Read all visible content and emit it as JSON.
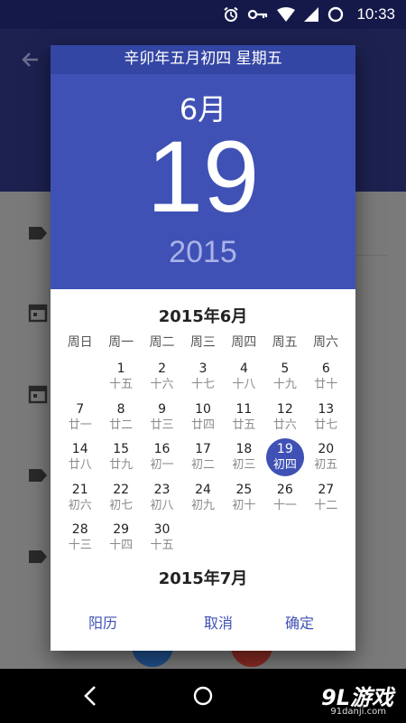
{
  "status_bar": {
    "time": "10:33",
    "icons": [
      "alarm-icon",
      "key-icon",
      "wifi-icon",
      "signal-icon",
      "battery-icon"
    ]
  },
  "dialog": {
    "lunar_header": "辛卯年五月初四 星期五",
    "selected_month": "6月",
    "selected_day": "19",
    "selected_year": "2015",
    "month_title": "2015年6月",
    "next_month_title": "2015年7月",
    "weekdays": [
      "周日",
      "周一",
      "周二",
      "周三",
      "周四",
      "周五",
      "周六"
    ],
    "days": [
      {
        "g": "1",
        "l": "十五"
      },
      {
        "g": "2",
        "l": "十六"
      },
      {
        "g": "3",
        "l": "十七"
      },
      {
        "g": "4",
        "l": "十八"
      },
      {
        "g": "5",
        "l": "十九"
      },
      {
        "g": "6",
        "l": "廿十"
      },
      {
        "g": "7",
        "l": "廿一"
      },
      {
        "g": "8",
        "l": "廿二"
      },
      {
        "g": "9",
        "l": "廿三"
      },
      {
        "g": "10",
        "l": "廿四"
      },
      {
        "g": "11",
        "l": "廿五"
      },
      {
        "g": "12",
        "l": "廿六"
      },
      {
        "g": "13",
        "l": "廿七"
      },
      {
        "g": "14",
        "l": "廿八"
      },
      {
        "g": "15",
        "l": "廿九"
      },
      {
        "g": "16",
        "l": "初一"
      },
      {
        "g": "17",
        "l": "初二"
      },
      {
        "g": "18",
        "l": "初三"
      },
      {
        "g": "19",
        "l": "初四",
        "selected": true
      },
      {
        "g": "20",
        "l": "初五"
      },
      {
        "g": "21",
        "l": "初六"
      },
      {
        "g": "22",
        "l": "初七"
      },
      {
        "g": "23",
        "l": "初八"
      },
      {
        "g": "24",
        "l": "初九"
      },
      {
        "g": "25",
        "l": "初十"
      },
      {
        "g": "26",
        "l": "十一"
      },
      {
        "g": "27",
        "l": "十二"
      },
      {
        "g": "28",
        "l": "十三"
      },
      {
        "g": "29",
        "l": "十四"
      },
      {
        "g": "30",
        "l": "十五"
      }
    ],
    "first_weekday_index": 1,
    "actions": {
      "solar": "阳历",
      "cancel": "取消",
      "ok": "确定"
    }
  },
  "watermark": {
    "brand": "9L游戏",
    "url": "91danji.com"
  },
  "colors": {
    "accent": "#3f51b5",
    "lunar_strip": "#3446a3",
    "year_text": "#aab3e8"
  }
}
